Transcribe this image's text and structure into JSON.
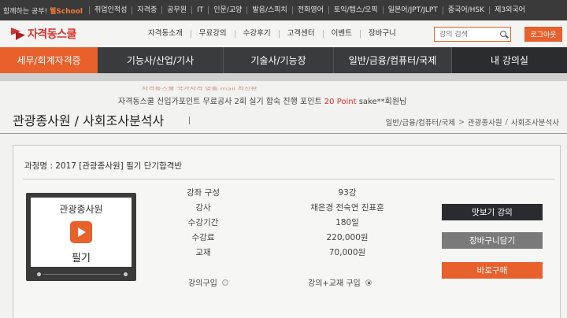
{
  "topbar": {
    "slogan_prefix": "함께하는 공부!",
    "slogan_brand": "웰School",
    "links": [
      "취업인적성",
      "자격증",
      "공무원",
      "IT",
      "인문/교양",
      "발음/스피치",
      "전화영어",
      "토익/텝스/오픽",
      "일본어/JPT/JLPT",
      "중국어/HSK",
      "제3외국어"
    ]
  },
  "header": {
    "logo": "자격동스쿨",
    "menu": [
      "자격동소개",
      "무료강의",
      "수강후기",
      "고객센터",
      "이벤트",
      "장바구니"
    ],
    "search_placeholder": "강의 검색",
    "login": "로그아웃"
  },
  "categories": [
    "세무/회계자격증",
    "기능사/산업/기사",
    "기술사/기능장",
    "일반/금융/컴퓨터/국제",
    "내 강의실"
  ],
  "notice": {
    "line1": "자격동스쿨 국가자격 맞춤 mail 최신판",
    "line2_prefix": "자격동스쿨 신입가포인트 무료공사 2회 실기 합숙 진행 포인트 ",
    "line2_highlight": "20 Point",
    "line2_suffix": " sake**회원님"
  },
  "page": {
    "title": "관광종사원 / 사회조사분석사",
    "breadcrumb": [
      "일반/금융/컴퓨터/국제",
      "관광종사원",
      "사회조사분석사"
    ]
  },
  "course": {
    "name_label": "과정명 : ",
    "name": "2017 [관광종사원] 필기 단기합격반",
    "thumb_title": "관광종사원",
    "thumb_sub": "필기",
    "info": [
      {
        "k": "강좌 구성",
        "v": "93강"
      },
      {
        "k": "강사",
        "v": "채은경 전숙연 진표훈"
      },
      {
        "k": "수강기간",
        "v": "180일"
      },
      {
        "k": "수강료",
        "v": "220,000원"
      },
      {
        "k": "교재",
        "v": "70,000원"
      }
    ],
    "option_lecture": "강의구입",
    "option_both": "강의+교재 구입"
  },
  "buttons": {
    "preview": "맛보기 강의",
    "cart": "장바구니담기",
    "buy": "바로구매"
  },
  "colors": {
    "accent": "#e8602c",
    "dark_nav": "#3a3b3d",
    "logo_red": "#d9302f"
  }
}
